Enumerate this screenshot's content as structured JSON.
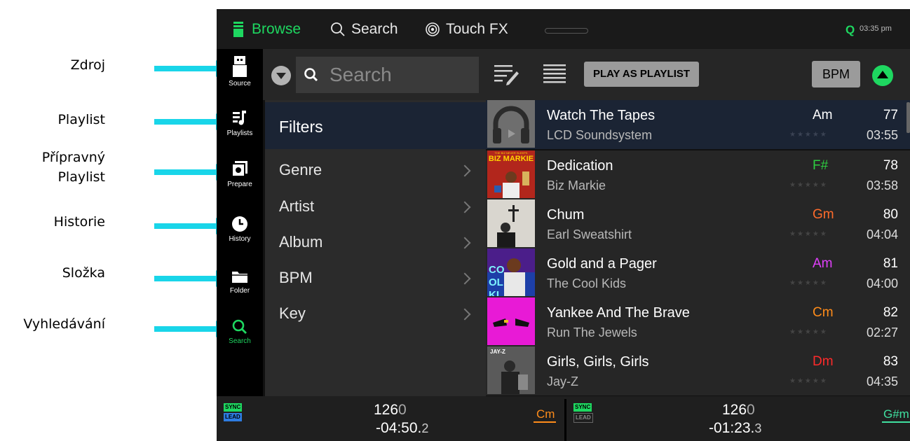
{
  "annotations": [
    {
      "label": "Zdroj"
    },
    {
      "label": "Playlist"
    },
    {
      "label": "Přípravný Playlist",
      "line1": "Přípravný",
      "line2": "Playlist"
    },
    {
      "label": "Historie"
    },
    {
      "label": "Složka"
    },
    {
      "label": "Vyhledávání"
    }
  ],
  "colors": {
    "accent": "#1ed760",
    "annotation_arrow": "#19d5e9",
    "selected_row": "#1b2434"
  },
  "topbar": {
    "browse_label": "Browse",
    "search_label": "Search",
    "touchfx_label": "Touch FX",
    "q_label": "Q",
    "clock": "03:35 pm"
  },
  "rail": [
    {
      "label": "Source",
      "icon": "usb-drive-icon"
    },
    {
      "label": "Playlists",
      "icon": "playlist-icon"
    },
    {
      "label": "Prepare",
      "icon": "prepare-icon"
    },
    {
      "label": "History",
      "icon": "clock-icon"
    },
    {
      "label": "Folder",
      "icon": "folder-icon"
    },
    {
      "label": "Search",
      "icon": "search-icon"
    }
  ],
  "toolbar": {
    "search_placeholder": "Search",
    "play_as_playlist": "PLAY AS PLAYLIST",
    "sort_label": "BPM"
  },
  "filters": {
    "header": "Filters",
    "items": [
      "Genre",
      "Artist",
      "Album",
      "BPM",
      "Key"
    ]
  },
  "tracks": [
    {
      "title": "Watch The Tapes",
      "artist": "LCD Soundsystem",
      "key": "Am",
      "key_color": "#ffffff",
      "bpm": "77",
      "duration": "03:55",
      "selected": true
    },
    {
      "title": "Dedication",
      "artist": "Biz Markie",
      "key": "F#",
      "key_color": "#2ecc40",
      "bpm": "78",
      "duration": "03:58",
      "selected": false,
      "art_text": "BIZ MARKIE",
      "art_subtext": "THE BIZ NEVER SLEEPS"
    },
    {
      "title": "Chum",
      "artist": "Earl Sweatshirt",
      "key": "Gm",
      "key_color": "#ff6b2b",
      "bpm": "80",
      "duration": "04:04",
      "selected": false
    },
    {
      "title": "Gold and a Pager",
      "artist": "The Cool Kids",
      "key": "Am",
      "key_color": "#e040fb",
      "bpm": "81",
      "duration": "04:00",
      "selected": false,
      "art_text": "COOL KIDS"
    },
    {
      "title": "Yankee And The Brave",
      "artist": "Run The Jewels",
      "key": "Cm",
      "key_color": "#ff8c1a",
      "bpm": "82",
      "duration": "02:27",
      "selected": false
    },
    {
      "title": "Girls, Girls, Girls",
      "artist": "Jay-Z",
      "key": "Dm",
      "key_color": "#ff2a2a",
      "bpm": "83",
      "duration": "04:35",
      "selected": false,
      "art_text": "JAY-Z"
    }
  ],
  "stars": "★★★★★",
  "decks": [
    {
      "sync": "SYNC",
      "lead": "LEAD",
      "bpm_main": "126",
      "bpm_frac": "0",
      "time_main": "-04:50.",
      "time_frac": "2",
      "key": "Cm",
      "key_color": "#ff8c1a",
      "lead_active": true
    },
    {
      "sync": "SYNC",
      "lead": "LEAD",
      "bpm_main": "126",
      "bpm_frac": "0",
      "time_main": "-01:23.",
      "time_frac": "3",
      "key": "G#m",
      "key_color": "#40e0a0",
      "lead_active": false
    }
  ]
}
